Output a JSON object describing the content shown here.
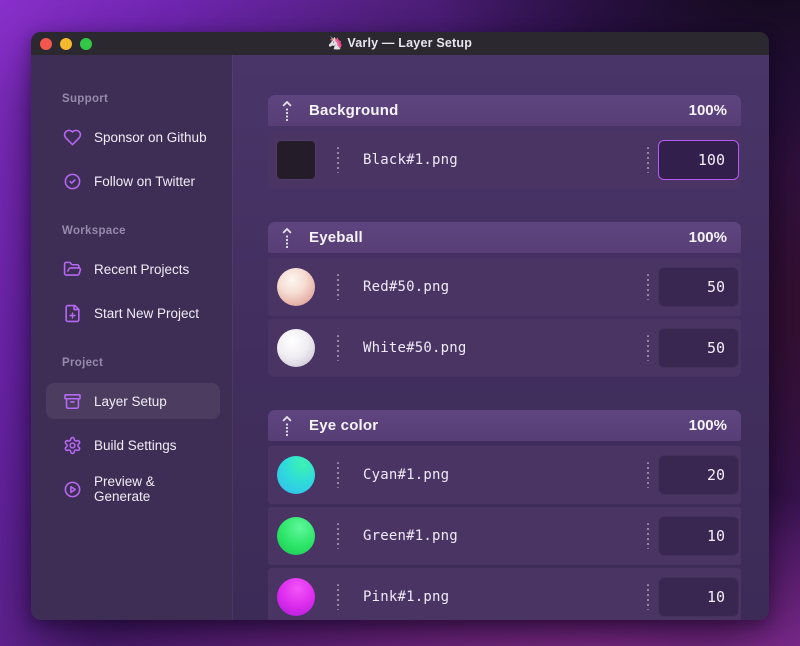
{
  "window": {
    "title_icon": "🦄",
    "title": "Varly — Layer Setup"
  },
  "colors": {
    "accent": "#b569f2",
    "focus_border": "#b45af8",
    "header_bg": "#5b4177",
    "row_bg": "#4a3464",
    "sidebar_bg": "#3e2d54",
    "main_bg": "#412e5e",
    "titlebar_bg": "#2b2830",
    "traffic_red": "#f3564d",
    "traffic_yellow": "#f5b92d",
    "traffic_green": "#33c748"
  },
  "sidebar": {
    "sections": [
      {
        "label": "Support",
        "items": [
          {
            "icon": "heart-icon",
            "label": "Sponsor on Github"
          },
          {
            "icon": "badge-check-icon",
            "label": "Follow on Twitter"
          }
        ]
      },
      {
        "label": "Workspace",
        "items": [
          {
            "icon": "folder-open-icon",
            "label": "Recent Projects"
          },
          {
            "icon": "file-plus-icon",
            "label": "Start New Project"
          }
        ]
      },
      {
        "label": "Project",
        "items": [
          {
            "icon": "archive-box-icon",
            "label": "Layer Setup",
            "active": true
          },
          {
            "icon": "gear-icon",
            "label": "Build Settings"
          },
          {
            "icon": "play-circle-icon",
            "label": "Preview & Generate"
          }
        ]
      }
    ]
  },
  "main": {
    "groups": [
      {
        "name": "Background",
        "opacity": "100%",
        "layers": [
          {
            "thumb": "black-square",
            "file": "Black#1.png",
            "value": "100",
            "focused": true
          }
        ]
      },
      {
        "name": "Eyeball",
        "opacity": "100%",
        "layers": [
          {
            "thumb": "red-ball",
            "file": "Red#50.png",
            "value": "50"
          },
          {
            "thumb": "white-ball",
            "file": "White#50.png",
            "value": "50"
          }
        ]
      },
      {
        "name": "Eye color",
        "opacity": "100%",
        "layers": [
          {
            "thumb": "cyan-ball",
            "file": "Cyan#1.png",
            "value": "20"
          },
          {
            "thumb": "green-ball",
            "file": "Green#1.png",
            "value": "10"
          },
          {
            "thumb": "pink-ball",
            "file": "Pink#1.png",
            "value": "10"
          }
        ]
      }
    ]
  }
}
